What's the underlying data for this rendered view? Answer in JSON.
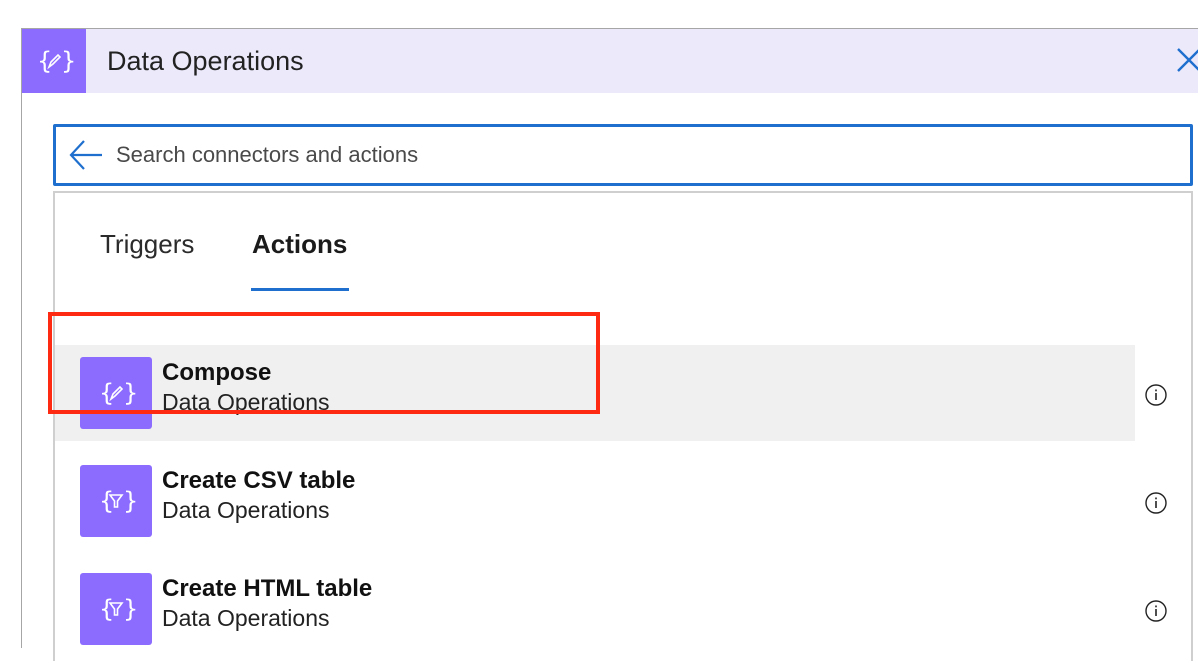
{
  "header": {
    "title": "Data Operations",
    "icon": "data-operations-icon",
    "accent_color": "#8c6cff",
    "background_color": "#ece9fb"
  },
  "search": {
    "placeholder": "Search connectors and actions",
    "value": ""
  },
  "tabs": [
    {
      "label": "Triggers",
      "active": false
    },
    {
      "label": "Actions",
      "active": true
    }
  ],
  "actions": [
    {
      "name": "Compose",
      "connector": "Data Operations",
      "icon": "compose-icon",
      "selected": true
    },
    {
      "name": "Create CSV table",
      "connector": "Data Operations",
      "icon": "filter-icon",
      "selected": false
    },
    {
      "name": "Create HTML table",
      "connector": "Data Operations",
      "icon": "filter-icon",
      "selected": false
    }
  ],
  "colors": {
    "focus_blue": "#1f6fce",
    "highlight_red": "#ff2a12"
  }
}
